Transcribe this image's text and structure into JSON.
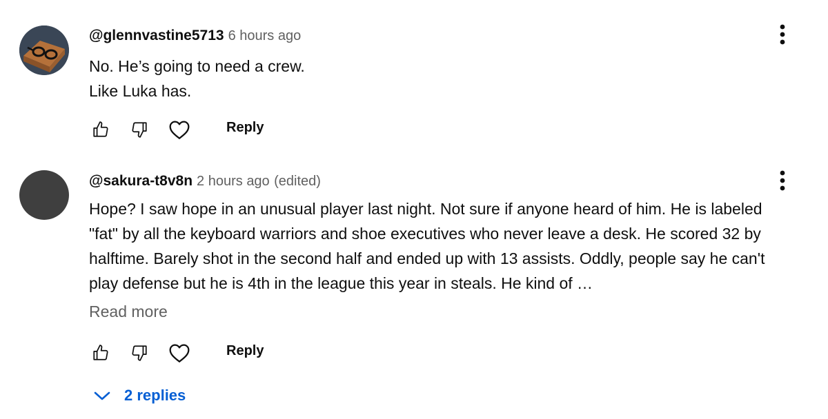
{
  "comments": [
    {
      "author": "@glennvastine5713",
      "time": "6 hours ago",
      "edited": "",
      "body": "No. He’s going to need a crew.\nLike Luka has.",
      "reply_label": "Reply"
    },
    {
      "author": "@sakura-t8v8n",
      "time": "2 hours ago",
      "edited": "(edited)",
      "body": "Hope?  I saw hope in an unusual player last night.  Not sure if anyone heard of him.  He is labeled \"fat\" by all the keyboard warriors and shoe executives who never leave a desk.  He scored 32 by halftime.  Barely shot in the second half and ended up with 13 assists.  Oddly, people say he can't play defense but he is 4th in the league this year in steals.  He kind of …",
      "read_more": "Read more",
      "reply_label": "Reply",
      "replies_label": "2 replies"
    }
  ],
  "icons": {
    "like": "thumbs-up-icon",
    "dislike": "thumbs-down-icon",
    "heart": "heart-icon",
    "more": "more-vert-icon",
    "expand": "chevron-down-icon"
  },
  "colors": {
    "text": "#0f0f0f",
    "secondary": "#606060",
    "link": "#065fd4",
    "avatar_dark": "#3f3f3f"
  }
}
